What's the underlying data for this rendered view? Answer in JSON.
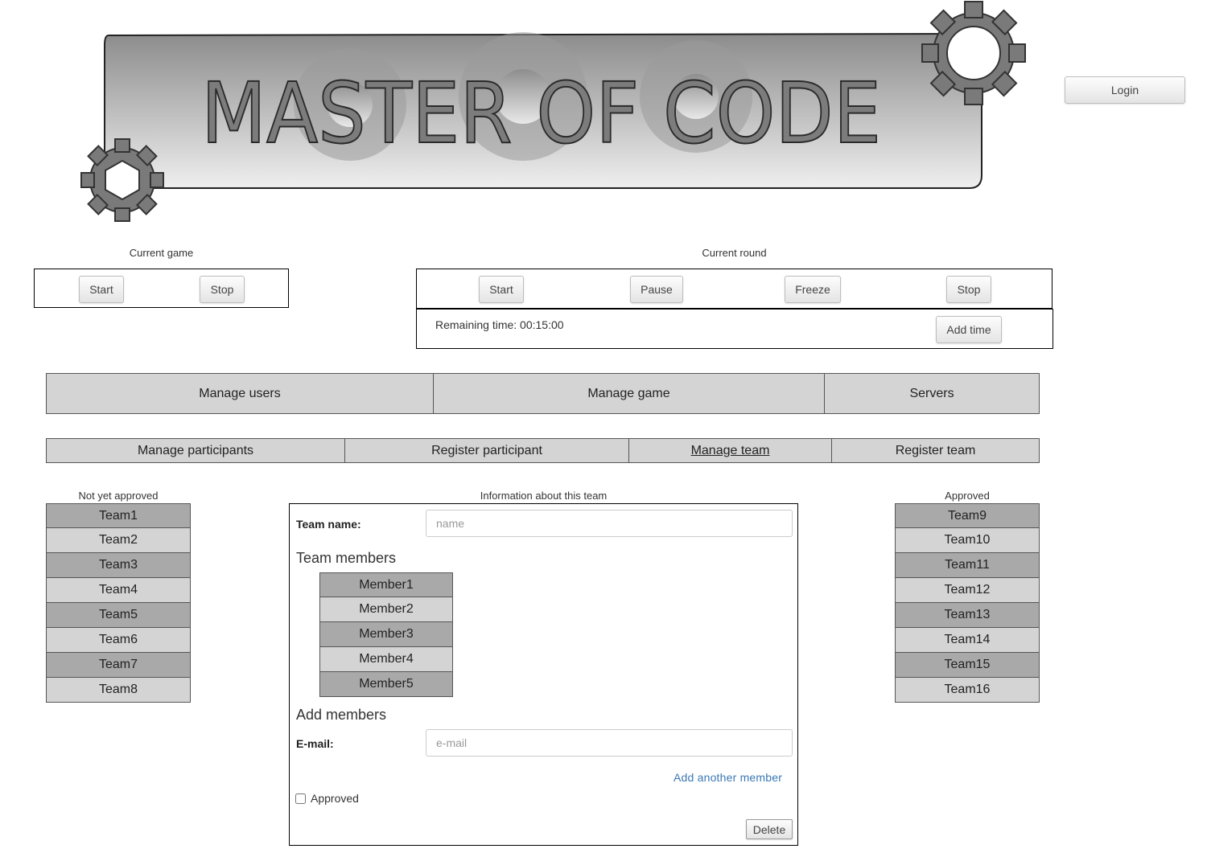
{
  "banner": {
    "title": "MASTER OF CODE"
  },
  "auth": {
    "login_label": "Login"
  },
  "current_game": {
    "caption": "Current game",
    "start_label": "Start",
    "stop_label": "Stop"
  },
  "current_round": {
    "caption": "Current round",
    "start_label": "Start",
    "pause_label": "Pause",
    "freeze_label": "Freeze",
    "stop_label": "Stop",
    "remaining_time": "Remaining time: 00:15:00",
    "add_time_label": "Add time"
  },
  "main_tabs": [
    "Manage users",
    "Manage game",
    "Servers"
  ],
  "sub_tabs": [
    "Manage participants",
    "Register participant",
    "Manage team",
    "Register team"
  ],
  "active_sub_tab": "Manage team",
  "not_approved": {
    "caption": "Not yet approved",
    "teams": [
      "Team1",
      "Team2",
      "Team3",
      "Team4",
      "Team5",
      "Team6",
      "Team7",
      "Team8"
    ]
  },
  "approved": {
    "caption": "Approved",
    "teams": [
      "Team9",
      "Team10",
      "Team11",
      "Team12",
      "Team13",
      "Team14",
      "Team15",
      "Team16"
    ]
  },
  "team_info": {
    "caption": "Information about this team",
    "team_name_label": "Team name:",
    "team_name_placeholder": "name",
    "members_title": "Team members",
    "members": [
      "Member1",
      "Member2",
      "Member3",
      "Member4",
      "Member5"
    ],
    "add_members_title": "Add members",
    "email_label": "E-mail:",
    "email_placeholder": "e-mail",
    "add_another_label": "Add another member",
    "approved_label": "Approved",
    "approved_checked": false,
    "delete_label": "Delete"
  },
  "colors": {
    "row_dark": "#a9a9a9",
    "row_light": "#d4d4d4",
    "link": "#3a78b5"
  }
}
